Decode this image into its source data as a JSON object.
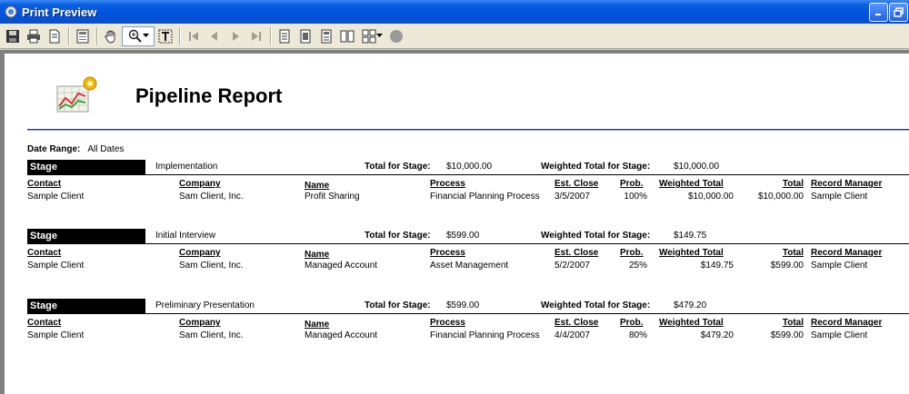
{
  "window": {
    "title": "Print Preview"
  },
  "toolbar": {
    "buttons": [
      "save-icon",
      "print-icon",
      "page-setup-icon",
      "layout-icon",
      "hand-icon",
      "zoom-icon",
      "text-select-icon",
      "first-page-icon",
      "prev-page-icon",
      "next-page-icon",
      "last-page-icon",
      "one-page-icon",
      "two-page-icon",
      "facing-page-icon",
      "multi-page-icon",
      "grid-page-icon",
      "close-preview-icon"
    ]
  },
  "report": {
    "title": "Pipeline Report",
    "date_range_label": "Date Range:",
    "date_range_value": "All Dates",
    "stage_label": "Stage",
    "total_for_stage_label": "Total for Stage:",
    "weighted_total_label": "Weighted Total for Stage:",
    "columns": {
      "contact": "Contact",
      "company": "Company",
      "name": "Name",
      "process": "Process",
      "est_close": "Est. Close",
      "prob": "Prob.",
      "weighted_total": "Weighted Total",
      "total": "Total",
      "record_manager": "Record Manager"
    },
    "stages": [
      {
        "name": "Implementation",
        "total": "$10,000.00",
        "weighted_total": "$10,000.00",
        "row": {
          "contact": "Sample Client",
          "company": "Sam Client, Inc.",
          "name": "Profit Sharing",
          "process": "Financial Planning Process",
          "est_close": "3/5/2007",
          "prob": "100%",
          "weighted_total": "$10,000.00",
          "total": "$10,000.00",
          "record_manager": "Sample Client"
        }
      },
      {
        "name": "Initial Interview",
        "total": "$599.00",
        "weighted_total": "$149.75",
        "row": {
          "contact": "Sample Client",
          "company": "Sam Client, Inc.",
          "name": "Managed Account",
          "process": "Asset Management",
          "est_close": "5/2/2007",
          "prob": "25%",
          "weighted_total": "$149.75",
          "total": "$599.00",
          "record_manager": "Sample Client"
        }
      },
      {
        "name": "Preliminary Presentation",
        "total": "$599.00",
        "weighted_total": "$479.20",
        "row": {
          "contact": "Sample Client",
          "company": "Sam Client, Inc.",
          "name": "Managed Account",
          "process": "Financial Planning Process",
          "est_close": "4/4/2007",
          "prob": "80%",
          "weighted_total": "$479.20",
          "total": "$599.00",
          "record_manager": "Sample Client"
        }
      }
    ]
  }
}
